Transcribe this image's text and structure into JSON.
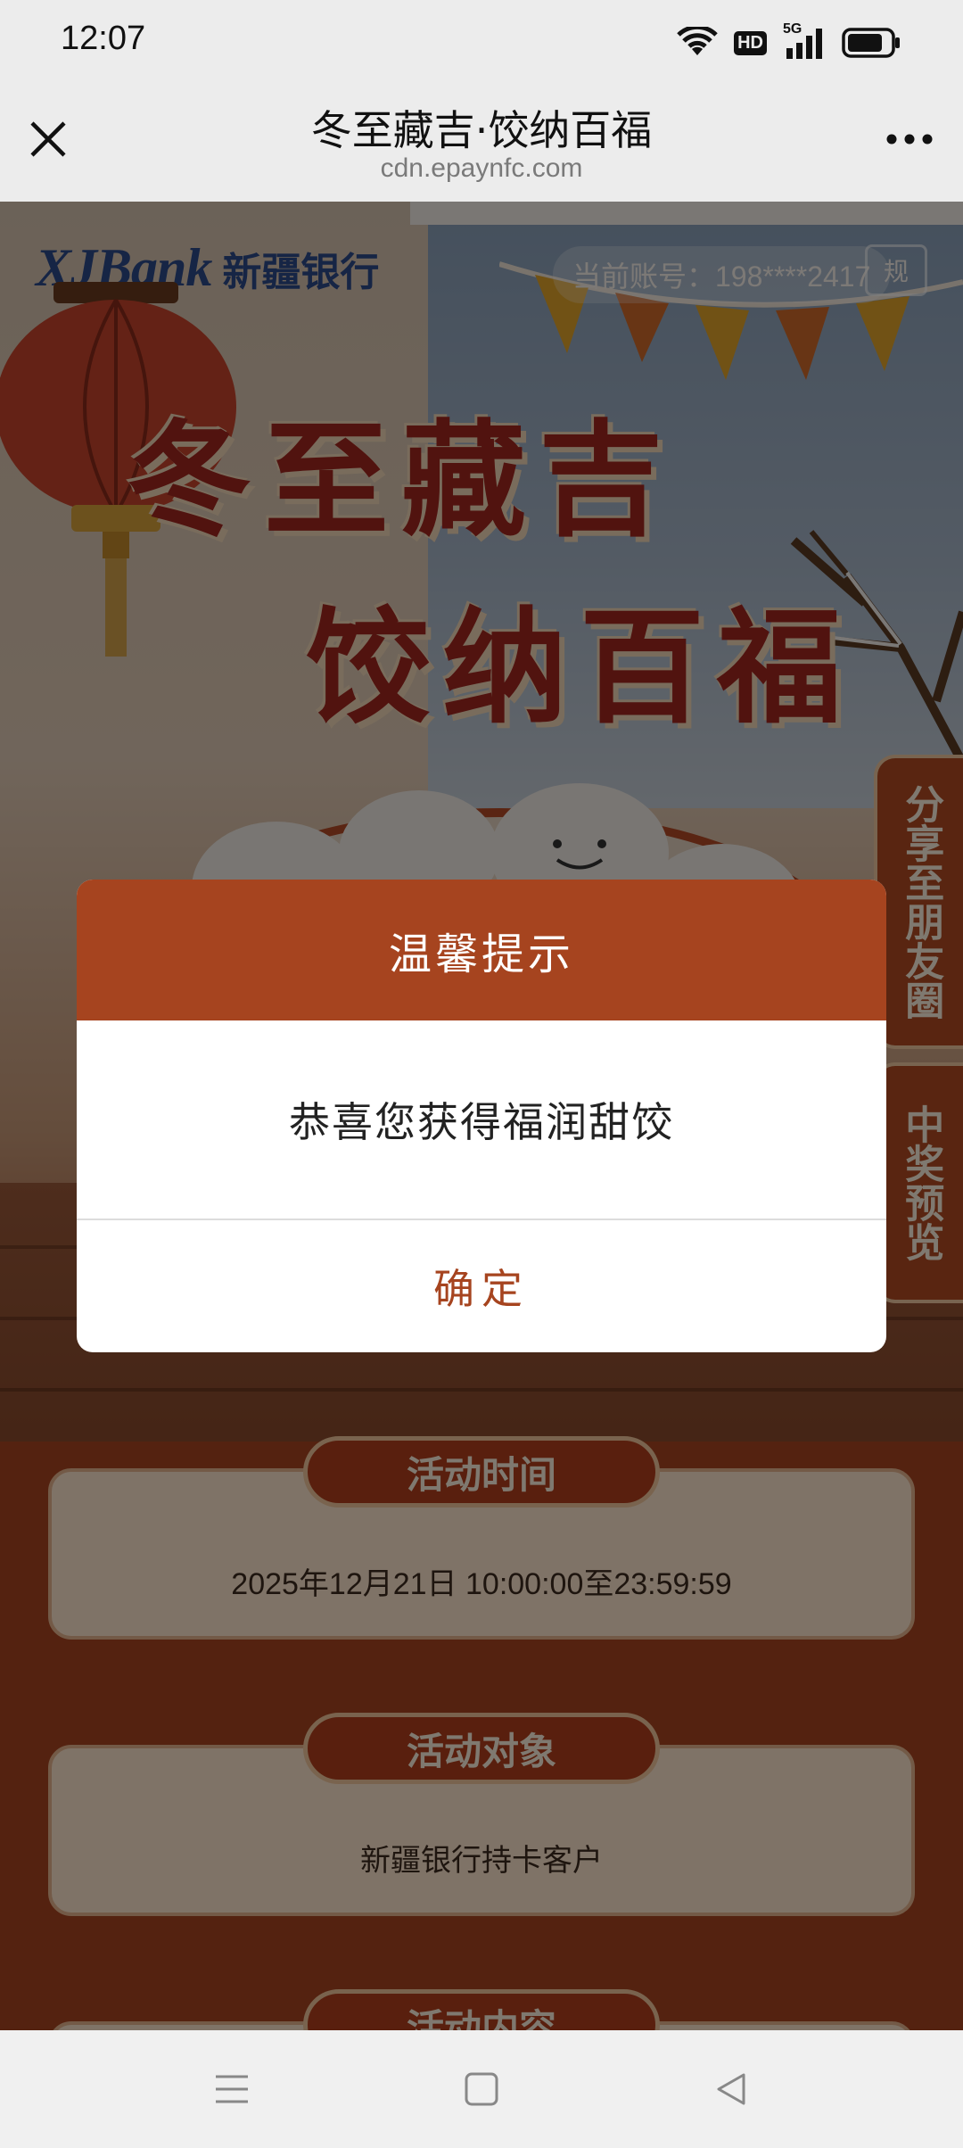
{
  "status_bar": {
    "time": "12:07",
    "network": "5G",
    "hd": "HD",
    "icons": [
      "wifi-icon",
      "hd-icon",
      "signal-5g-icon",
      "battery-icon"
    ]
  },
  "nav": {
    "title": "冬至藏吉·饺纳百福",
    "url": "cdn.epaynfc.com",
    "close_icon": "close-icon",
    "more_icon": "more-icon"
  },
  "hero": {
    "bank_logo_latin": "XJBank",
    "bank_logo_cn": "新疆银行",
    "account_label": "当前账号：198****2417",
    "rules_badge": "规",
    "title_line1": "冬至藏吉",
    "title_line2": "饺纳百福"
  },
  "side_tabs": {
    "share": "分享至朋友圈",
    "prize": "中奖预览"
  },
  "sections": {
    "time_label": "活动时间",
    "time_value": "2025年12月21日 10:00:00至23:59:59",
    "target_label": "活动对象",
    "target_value": "新疆银行持卡客户",
    "content_label": "活动内容"
  },
  "dialog": {
    "title": "温馨提示",
    "message": "恭喜您获得福润甜饺",
    "confirm": "确定"
  },
  "colors": {
    "accent": "#a6441f",
    "dialog_bg": "#ffffff",
    "overlay": "rgba(0,0,0,0.5)"
  }
}
